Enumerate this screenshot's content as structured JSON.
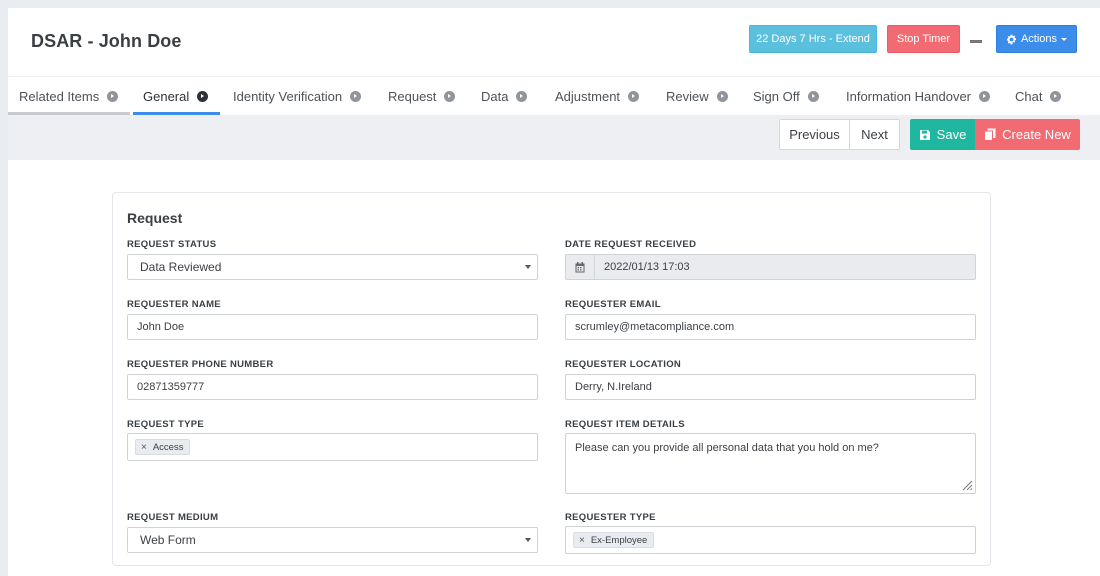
{
  "header": {
    "title": "DSAR - John Doe",
    "extend_label": "22 Days 7 Hrs - Extend",
    "stop_timer_label": "Stop Timer",
    "actions_label": "Actions"
  },
  "tabs": [
    {
      "label": "Related Items"
    },
    {
      "label": "General"
    },
    {
      "label": "Identity Verification"
    },
    {
      "label": "Request"
    },
    {
      "label": "Data"
    },
    {
      "label": "Adjustment"
    },
    {
      "label": "Review"
    },
    {
      "label": "Sign Off"
    },
    {
      "label": "Information Handover"
    },
    {
      "label": "Chat"
    }
  ],
  "active_tab": "General",
  "toolbar": {
    "previous_label": "Previous",
    "next_label": "Next",
    "save_label": "Save",
    "create_new_label": "Create New"
  },
  "form": {
    "section_title": "Request",
    "request_status": {
      "label": "REQUEST STATUS",
      "value": "Data Reviewed"
    },
    "date_received": {
      "label": "DATE REQUEST RECEIVED",
      "value": "2022/01/13 17:03"
    },
    "requester_name": {
      "label": "REQUESTER NAME",
      "value": "John Doe"
    },
    "requester_email": {
      "label": "REQUESTER EMAIL",
      "value": "scrumley@metacompliance.com"
    },
    "requester_phone": {
      "label": "REQUESTER PHONE NUMBER",
      "value": "02871359777"
    },
    "requester_location": {
      "label": "REQUESTER LOCATION",
      "value": "Derry, N.Ireland"
    },
    "request_type": {
      "label": "REQUEST TYPE",
      "tags": [
        "Access"
      ]
    },
    "request_item_details": {
      "label": "REQUEST ITEM DETAILS",
      "value": "Please can you provide all personal data that you hold on me?"
    },
    "request_medium": {
      "label": "REQUEST MEDIUM",
      "value": "Web Form"
    },
    "requester_type": {
      "label": "REQUESTER TYPE",
      "tags": [
        "Ex-Employee"
      ]
    }
  },
  "colors": {
    "extend": "#5bc0de",
    "stop_timer": "#f26b73",
    "actions": "#3c8dea",
    "save": "#1fb79f",
    "create_new": "#f26b73",
    "tab_active_underline": "#3c8dea",
    "tab_related_underline": "#c8cbd0"
  },
  "icons": {
    "tab_arrow": "circle-arrow-right-icon",
    "actions": "gear-icon",
    "save": "floppy-disk-icon",
    "create_new": "copy-icon",
    "date": "calendar-icon",
    "tag_remove": "close-icon"
  }
}
